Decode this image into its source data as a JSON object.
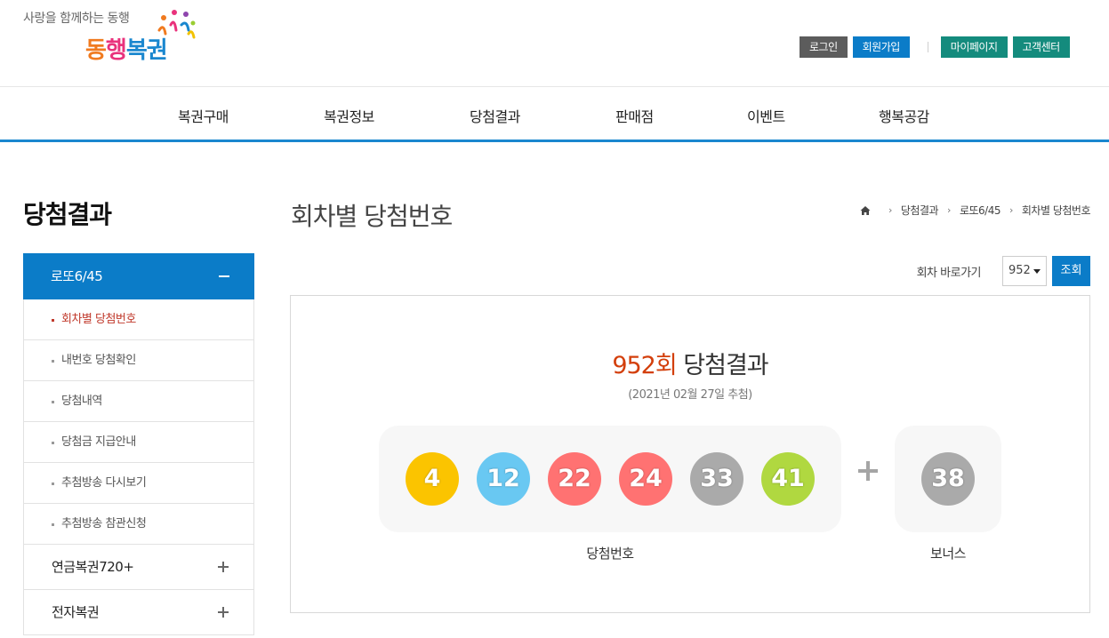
{
  "header": {
    "tagline": "사랑을 함께하는 동행",
    "brand": [
      "동",
      "행",
      "복",
      "권"
    ],
    "util": {
      "login": "로그인",
      "signup": "회원가입",
      "mypage": "마이페이지",
      "support": "고객센터"
    }
  },
  "gnb": [
    "복권구매",
    "복권정보",
    "당첨결과",
    "판매점",
    "이벤트",
    "행복공감"
  ],
  "sidebar": {
    "title": "당첨결과",
    "active_group": "로또6/45",
    "sub_items": [
      {
        "label": "회차별 당첨번호",
        "active": true
      },
      {
        "label": "내번호 당첨확인",
        "active": false
      },
      {
        "label": "당첨내역",
        "active": false
      },
      {
        "label": "당첨금 지급안내",
        "active": false
      },
      {
        "label": "추첨방송 다시보기",
        "active": false
      },
      {
        "label": "추첨방송 참관신청",
        "active": false
      }
    ],
    "groups": [
      "연금복권720+",
      "전자복권"
    ]
  },
  "main": {
    "title": "회차별 당첨번호",
    "breadcrumb": [
      "당첨결과",
      "로또6/45",
      "회차별 당첨번호"
    ],
    "search": {
      "label": "회차 바로가기",
      "selected_round": "952",
      "button": "조회"
    },
    "result": {
      "round": "952회",
      "title_suffix": " 당첨결과",
      "date": "(2021년 02월 27일 추첨)",
      "numbers": [
        {
          "value": "4",
          "color": "#fbc400"
        },
        {
          "value": "12",
          "color": "#69c8f2"
        },
        {
          "value": "22",
          "color": "#ff7272"
        },
        {
          "value": "24",
          "color": "#ff7272"
        },
        {
          "value": "33",
          "color": "#aaaaaa"
        },
        {
          "value": "41",
          "color": "#b0d840"
        }
      ],
      "bonus": {
        "value": "38",
        "color": "#aaaaaa"
      },
      "numbers_caption": "당첨번호",
      "bonus_caption": "보너스"
    }
  }
}
